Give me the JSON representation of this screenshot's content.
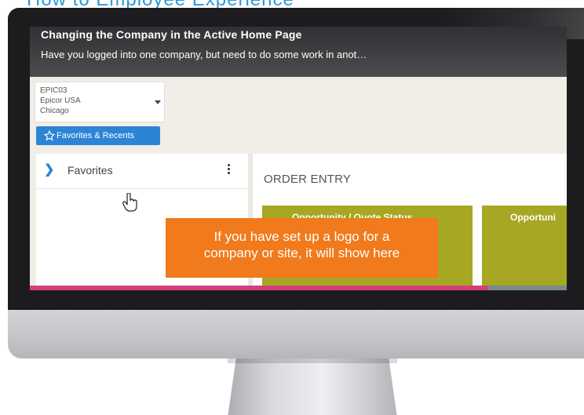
{
  "header": {
    "partial_text": "How to Employee Experience"
  },
  "banner": {
    "title": "Changing the Company in the Active Home Page",
    "subtitle": "Have you logged into one company, but need to do some work in anot…"
  },
  "company_selector": {
    "line1": "EPIC03",
    "line2": "Epicor USA",
    "line3": "Chicago"
  },
  "favorites_button": {
    "label": "Favorites & Recents"
  },
  "sidebar": {
    "favorites_label": "Favorites"
  },
  "content": {
    "section_title": "ORDER ENTRY",
    "tiles": [
      {
        "label": "Opportunity / Quote Status"
      },
      {
        "label": "Opportuni"
      }
    ]
  },
  "callout": {
    "line1": "If you have set up a logo for a",
    "line2": "company or site, it will show here"
  },
  "colors": {
    "accent_blue": "#2c84d6",
    "tile_olive": "#a6a723",
    "callout_orange": "#f07a1c",
    "bar_pink": "#d3407d"
  },
  "icons": [
    "star-icon",
    "chevron-right-icon",
    "kebab-menu-icon",
    "hand-pointer-icon",
    "dropdown-caret-icon"
  ]
}
